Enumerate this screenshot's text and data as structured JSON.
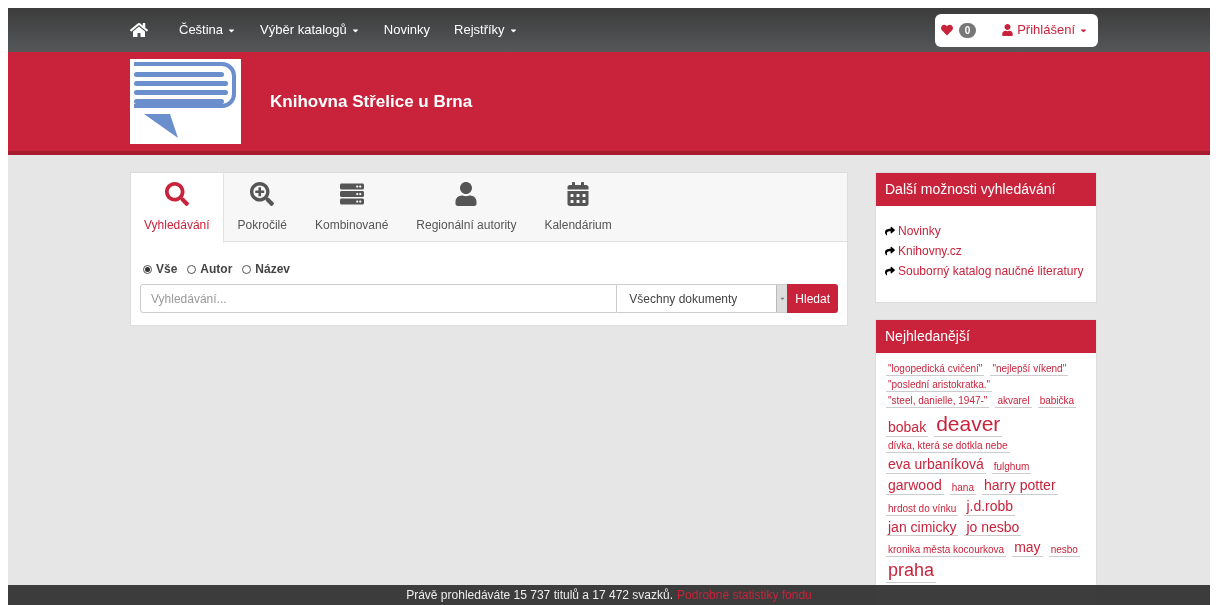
{
  "nav": {
    "items": [
      {
        "label": "Čeština",
        "dropdown": true
      },
      {
        "label": "Výběr katalogů",
        "dropdown": true
      },
      {
        "label": "Novinky",
        "dropdown": false
      },
      {
        "label": "Rejstříky",
        "dropdown": true
      }
    ],
    "favorites_count": "0",
    "login": "Přihlášení"
  },
  "header": {
    "title": "Knihovna Střelice u Brna"
  },
  "search": {
    "tabs": [
      {
        "label": "Vyhledávání",
        "selected": true
      },
      {
        "label": "Pokročilé",
        "selected": false
      },
      {
        "label": "Kombinované",
        "selected": false
      },
      {
        "label": "Regionální autority",
        "selected": false
      },
      {
        "label": "Kalendárium",
        "selected": false
      }
    ],
    "scopes": [
      {
        "label": "Vše",
        "selected": true
      },
      {
        "label": "Autor",
        "selected": false
      },
      {
        "label": "Název",
        "selected": false
      }
    ],
    "placeholder": "Vyhledávání...",
    "document_type": "Všechny dokumenty",
    "button": "Hledat"
  },
  "more_options": {
    "title": "Další možnosti vyhledávání",
    "links": [
      "Novinky",
      "Knihovny.cz",
      "Souborný katalog naučné literatury"
    ]
  },
  "most_searched": {
    "title": "Nejhledanější",
    "tags": [
      {
        "label": "\"logopedická cvičení\"",
        "kind": "small"
      },
      {
        "label": "\"nejlepší víkend\"",
        "kind": "small"
      },
      {
        "label": "\"poslední aristokratka.\"",
        "kind": "small"
      },
      {
        "label": "\"steel, danielle, 1947-\"",
        "kind": "small"
      },
      {
        "label": "akvarel",
        "kind": "small"
      },
      {
        "label": "babička",
        "kind": "small"
      },
      {
        "label": "bobak",
        "kind": "medium"
      },
      {
        "label": "deaver",
        "kind": "xlarge"
      },
      {
        "label": "dívka, která se dotkla nebe",
        "kind": "small"
      },
      {
        "label": "eva urbaníková",
        "kind": "medium"
      },
      {
        "label": "fulghum",
        "kind": "small"
      },
      {
        "label": "garwood",
        "kind": "medium"
      },
      {
        "label": "hana",
        "kind": "small"
      },
      {
        "label": "harry potter",
        "kind": "medium"
      },
      {
        "label": "hrdost do vínku",
        "kind": "small"
      },
      {
        "label": "j.d.robb",
        "kind": "medium"
      },
      {
        "label": "jan cimicky",
        "kind": "medium"
      },
      {
        "label": "jo nesbo",
        "kind": "medium"
      },
      {
        "label": "kronika města kocourkova",
        "kind": "small"
      },
      {
        "label": "may",
        "kind": "medium"
      },
      {
        "label": "nesbo",
        "kind": "small"
      },
      {
        "label": "praha",
        "kind": "large"
      }
    ]
  },
  "footer": {
    "text": "Právě prohledáváte 15 737 titulů a 17 472 svazků.",
    "link": "Podrobné statistiky fondu"
  }
}
